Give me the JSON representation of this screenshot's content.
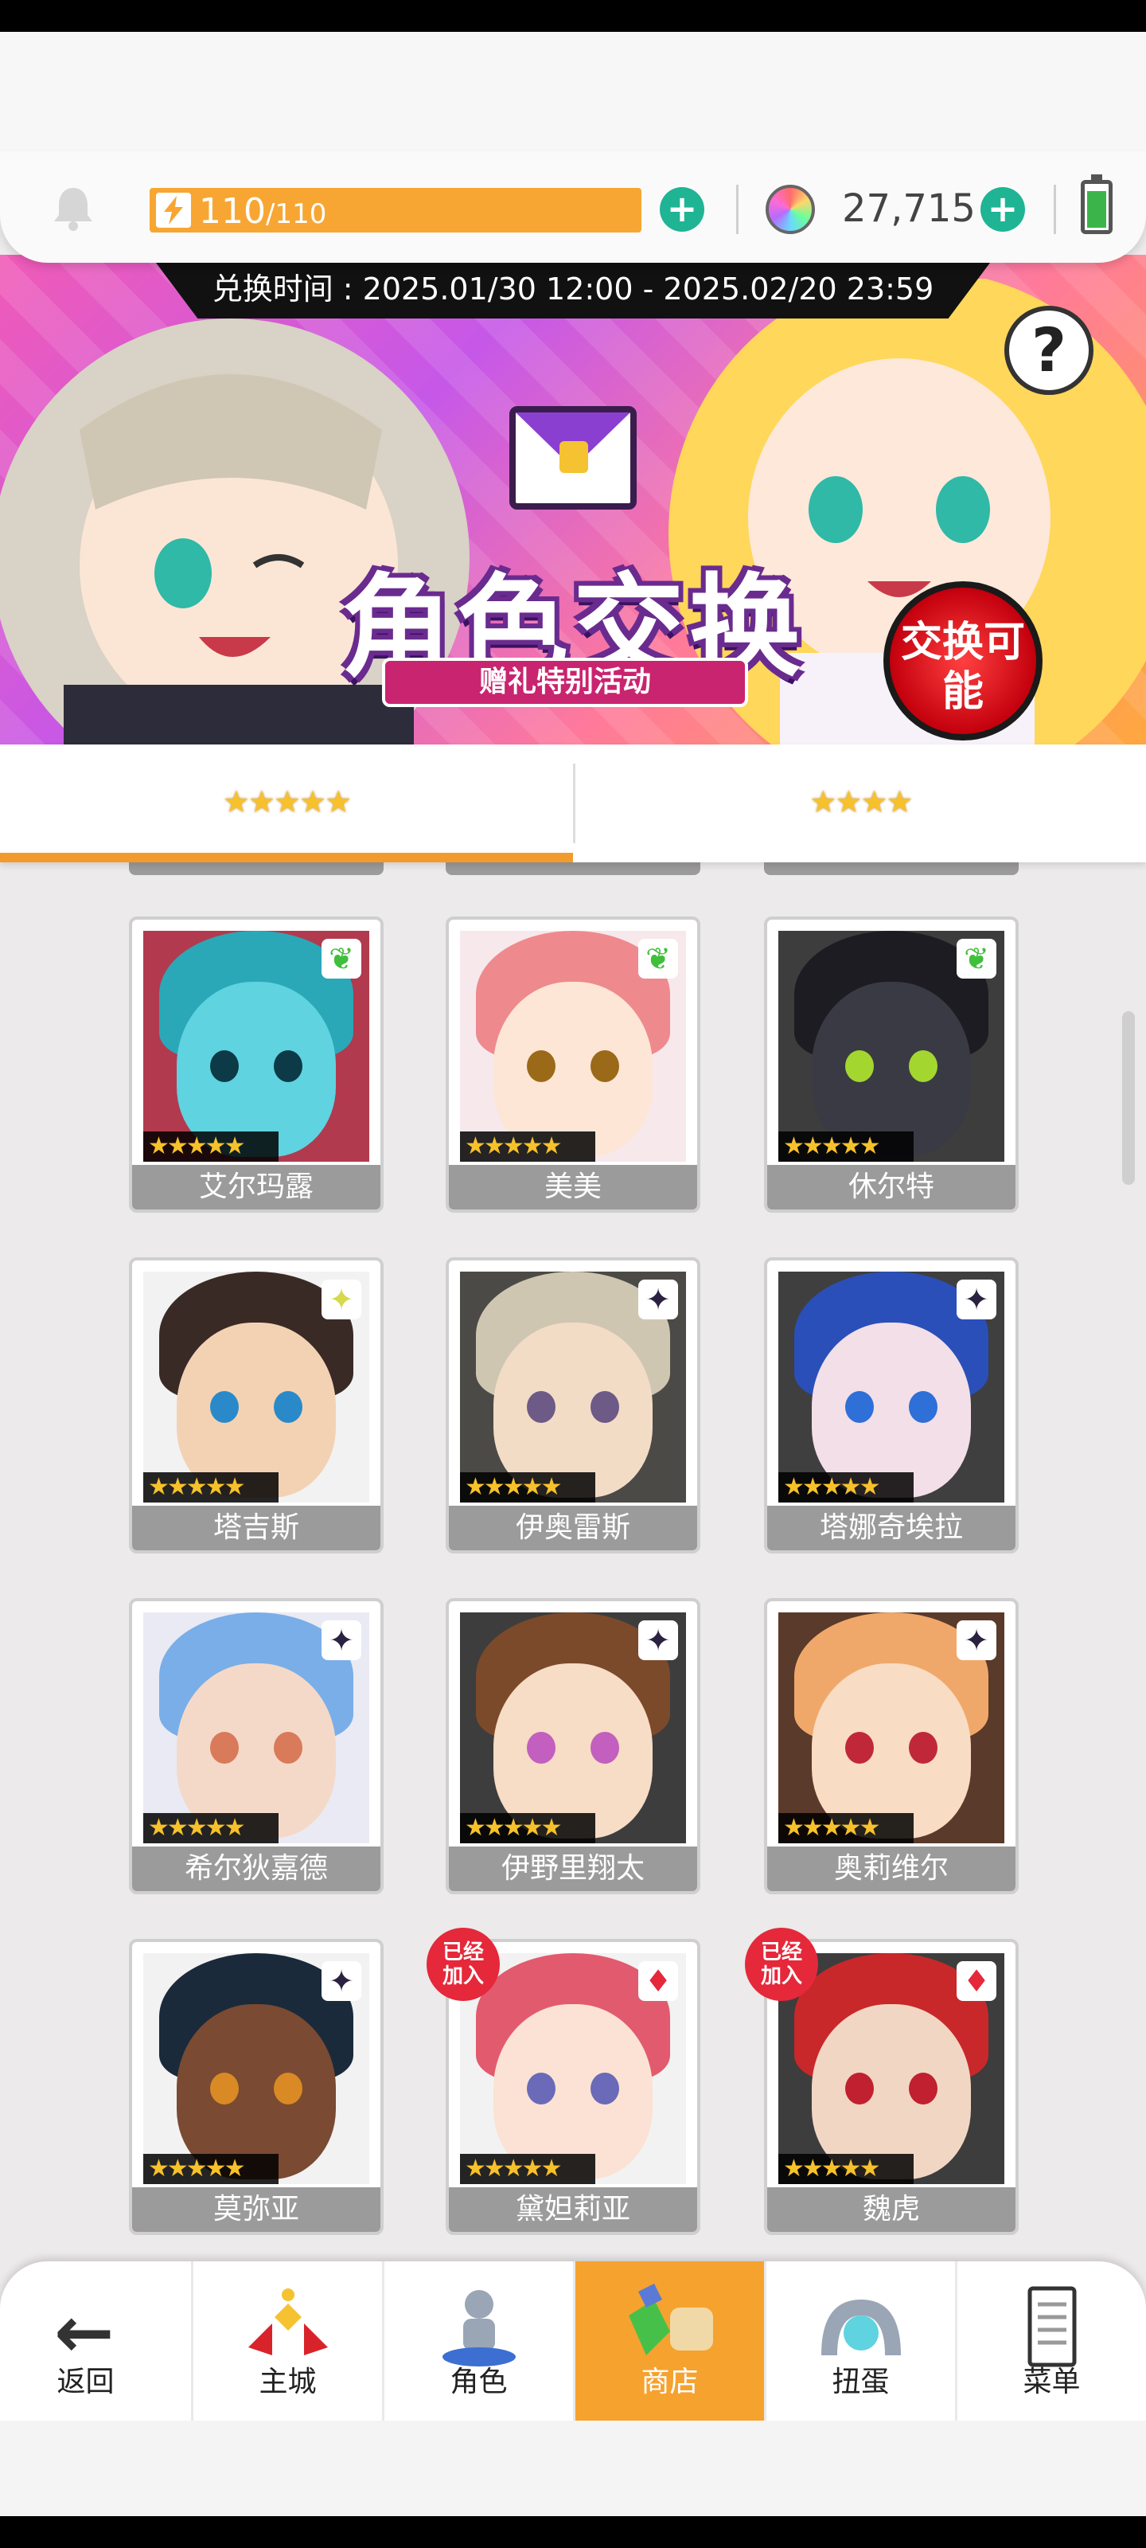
{
  "resources": {
    "stamina_current": "110",
    "stamina_max": "/110",
    "gems": "27,715",
    "plus_label": "+"
  },
  "banner": {
    "exchange_time": "兑换时间 : 2025.01/30 12:00 - 2025.02/20 23:59",
    "title": "角色交换",
    "subtitle": "赠礼特别活动",
    "badge": "交换可能",
    "help": "?"
  },
  "tabs": [
    {
      "stars": "★★★★★",
      "active": true
    },
    {
      "stars": "★★★★",
      "active": false
    }
  ],
  "cards": [
    {
      "name": "艾尔玛露",
      "stars": "★★★★★",
      "element": "leaf-icon",
      "glyph": "❦",
      "elem_color": "#3fbf3a",
      "joined": false,
      "bg": "#b23a4e",
      "hair": "#2aa8b8",
      "skin": "#5fd3e0",
      "eye": "#0c3a46"
    },
    {
      "name": "美美",
      "stars": "★★★★★",
      "element": "leaf-icon",
      "glyph": "❦",
      "elem_color": "#3fbf3a",
      "joined": false,
      "bg": "#f7e8ec",
      "hair": "#ee8a8e",
      "skin": "#fde6d6",
      "eye": "#9a6a18"
    },
    {
      "name": "休尔特",
      "stars": "★★★★★",
      "element": "leaf-icon",
      "glyph": "❦",
      "elem_color": "#3fbf3a",
      "joined": false,
      "bg": "#3d3d3d",
      "hair": "#1c1c22",
      "skin": "#3a3a44",
      "eye": "#a4d630"
    },
    {
      "name": "塔吉斯",
      "stars": "★★★★★",
      "element": "light-icon",
      "glyph": "✦",
      "elem_color": "#d5d94a",
      "joined": false,
      "bg": "#f2f2f2",
      "hair": "#3a2a26",
      "skin": "#f3d2b4",
      "eye": "#2a8ac9"
    },
    {
      "name": "伊奥雷斯",
      "stars": "★★★★★",
      "element": "dark-icon",
      "glyph": "✦",
      "elem_color": "#2a2240",
      "joined": false,
      "bg": "#4c4a46",
      "hair": "#cfc6b2",
      "skin": "#f2dcc6",
      "eye": "#6d5a86"
    },
    {
      "name": "塔娜奇埃拉",
      "stars": "★★★★★",
      "element": "dark-icon",
      "glyph": "✦",
      "elem_color": "#2a2240",
      "joined": false,
      "bg": "#3f3f3f",
      "hair": "#2a4fb8",
      "skin": "#f3dfe8",
      "eye": "#2e6fd8"
    },
    {
      "name": "希尔狄嘉德",
      "stars": "★★★★★",
      "element": "dark-icon",
      "glyph": "✦",
      "elem_color": "#2a2240",
      "joined": false,
      "bg": "#eaeaf4",
      "hair": "#7aaee8",
      "skin": "#f5d9c8",
      "eye": "#d97a5a"
    },
    {
      "name": "伊野里翔太",
      "stars": "★★★★★",
      "element": "dark-icon",
      "glyph": "✦",
      "elem_color": "#2a2240",
      "joined": false,
      "bg": "#3d3d3d",
      "hair": "#7b4a2a",
      "skin": "#f7dcc6",
      "eye": "#c25fbf"
    },
    {
      "name": "奥莉维尔",
      "stars": "★★★★★",
      "element": "dark-icon",
      "glyph": "✦",
      "elem_color": "#2a2240",
      "joined": false,
      "bg": "#5a3a2a",
      "hair": "#f0a86a",
      "skin": "#f9dcc4",
      "eye": "#c0283a"
    },
    {
      "name": "莫弥亚",
      "stars": "★★★★★",
      "element": "dark-icon",
      "glyph": "✦",
      "elem_color": "#2a2240",
      "joined": false,
      "bg": "#f2f2f2",
      "hair": "#1a2a3a",
      "skin": "#7a4a32",
      "eye": "#d98a24"
    },
    {
      "name": "黛妲莉亚",
      "stars": "★★★★★",
      "element": "fire-icon",
      "glyph": "♦",
      "elem_color": "#e5283a",
      "joined": true,
      "bg": "#f2f2f2",
      "hair": "#e25a6e",
      "skin": "#fbe2d4",
      "eye": "#6a6ab8"
    },
    {
      "name": "魏虎",
      "stars": "★★★★★",
      "element": "fire-icon",
      "glyph": "♦",
      "elem_color": "#e5283a",
      "joined": true,
      "bg": "#3d3d3d",
      "hair": "#c8282a",
      "skin": "#f2d6c4",
      "eye": "#c02030"
    }
  ],
  "joined_label": "已经加入",
  "nav": [
    {
      "label": "返回",
      "icon": "back-arrow-icon"
    },
    {
      "label": "主城",
      "icon": "castle-icon"
    },
    {
      "label": "角色",
      "icon": "character-icon"
    },
    {
      "label": "商店",
      "icon": "shop-icon",
      "active": true
    },
    {
      "label": "扭蛋",
      "icon": "gacha-icon"
    },
    {
      "label": "菜单",
      "icon": "menu-icon"
    }
  ],
  "colors": {
    "accent": "#f6a22e",
    "plus": "#1fb494",
    "stamina": "#f7a633",
    "joined_badge": "#e5283a"
  }
}
